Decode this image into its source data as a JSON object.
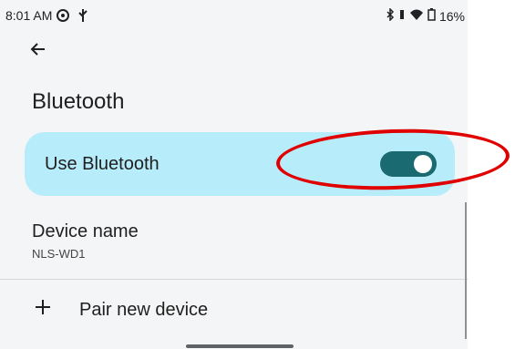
{
  "status_bar": {
    "time": "8:01 AM",
    "battery": "16%",
    "icons": [
      "settings-icon",
      "usb-icon",
      "bluetooth-icon",
      "vibrate-icon",
      "wifi-icon",
      "battery-icon"
    ]
  },
  "header": {
    "title": "Bluetooth",
    "back_icon": "back-arrow-icon"
  },
  "toggle": {
    "label": "Use Bluetooth",
    "state": "on",
    "colors": {
      "row_bg": "#b7ecfb",
      "switch_track": "#1a6a72"
    }
  },
  "device": {
    "title": "Device name",
    "value": "NLS-WD1"
  },
  "pair": {
    "label": "Pair new device",
    "icon": "plus-icon"
  },
  "annotation": {
    "color": "#e00000"
  }
}
